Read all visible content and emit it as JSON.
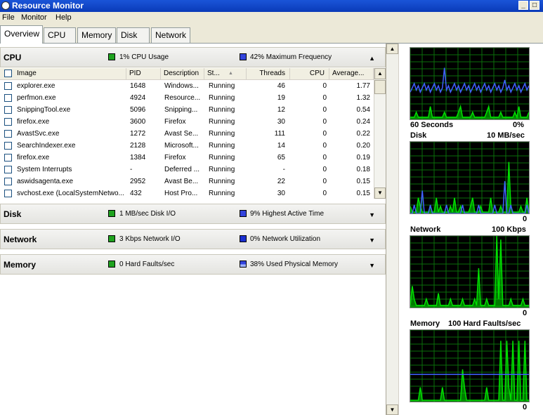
{
  "window": {
    "title": "Resource Monitor"
  },
  "menu": [
    "File",
    "Monitor",
    "Help"
  ],
  "tabs": [
    "Overview",
    "CPU",
    "Memory",
    "Disk",
    "Network"
  ],
  "colors": {
    "green_stat": "#1fa31f",
    "blue_stat": "#3344dd",
    "graph_green": "#00e000",
    "graph_blue": "#4060ff",
    "grid_line": "#0a6e0a"
  },
  "cpu": {
    "title": "CPU",
    "stat1": "1% CPU Usage",
    "stat2": "42% Maximum Frequency",
    "columns": [
      "Image",
      "PID",
      "Description",
      "St...",
      "Threads",
      "CPU",
      "Average..."
    ],
    "rows": [
      [
        "explorer.exe",
        "1648",
        "Windows...",
        "Running",
        "46",
        "0",
        "1.77"
      ],
      [
        "perfmon.exe",
        "4924",
        "Resource...",
        "Running",
        "19",
        "0",
        "1.32"
      ],
      [
        "SnippingTool.exe",
        "5096",
        "Snipping...",
        "Running",
        "12",
        "0",
        "0.54"
      ],
      [
        "firefox.exe",
        "3600",
        "Firefox",
        "Running",
        "30",
        "0",
        "0.24"
      ],
      [
        "AvastSvc.exe",
        "1272",
        "Avast Se...",
        "Running",
        "111",
        "0",
        "0.22"
      ],
      [
        "SearchIndexer.exe",
        "2128",
        "Microsoft...",
        "Running",
        "14",
        "0",
        "0.20"
      ],
      [
        "firefox.exe",
        "1384",
        "Firefox",
        "Running",
        "65",
        "0",
        "0.19"
      ],
      [
        "System Interrupts",
        "-",
        "Deferred ...",
        "Running",
        "-",
        "0",
        "0.18"
      ],
      [
        "aswidsagenta.exe",
        "2952",
        "Avast Be...",
        "Running",
        "22",
        "0",
        "0.15"
      ],
      [
        "svchost.exe (LocalSystemNetwo...",
        "432",
        "Host Pro...",
        "Running",
        "30",
        "0",
        "0.15"
      ]
    ]
  },
  "disk": {
    "title": "Disk",
    "stat1": "1 MB/sec Disk I/O",
    "stat2": "9% Highest Active Time"
  },
  "network": {
    "title": "Network",
    "stat1": "3 Kbps Network I/O",
    "stat2": "0% Network Utilization"
  },
  "memory": {
    "title": "Memory",
    "stat1": "0 Hard Faults/sec",
    "stat2": "38% Used Physical Memory"
  },
  "graphs": {
    "cpu": {
      "left_label": "60 Seconds",
      "right_label": "0%"
    },
    "disk": {
      "title": "Disk",
      "scale": "10 MB/sec",
      "min": "0"
    },
    "network": {
      "title": "Network",
      "scale": "100 Kbps",
      "min": "0"
    },
    "memory": {
      "title": "Memory",
      "scale": "100 Hard Faults/sec",
      "min": "0"
    }
  }
}
